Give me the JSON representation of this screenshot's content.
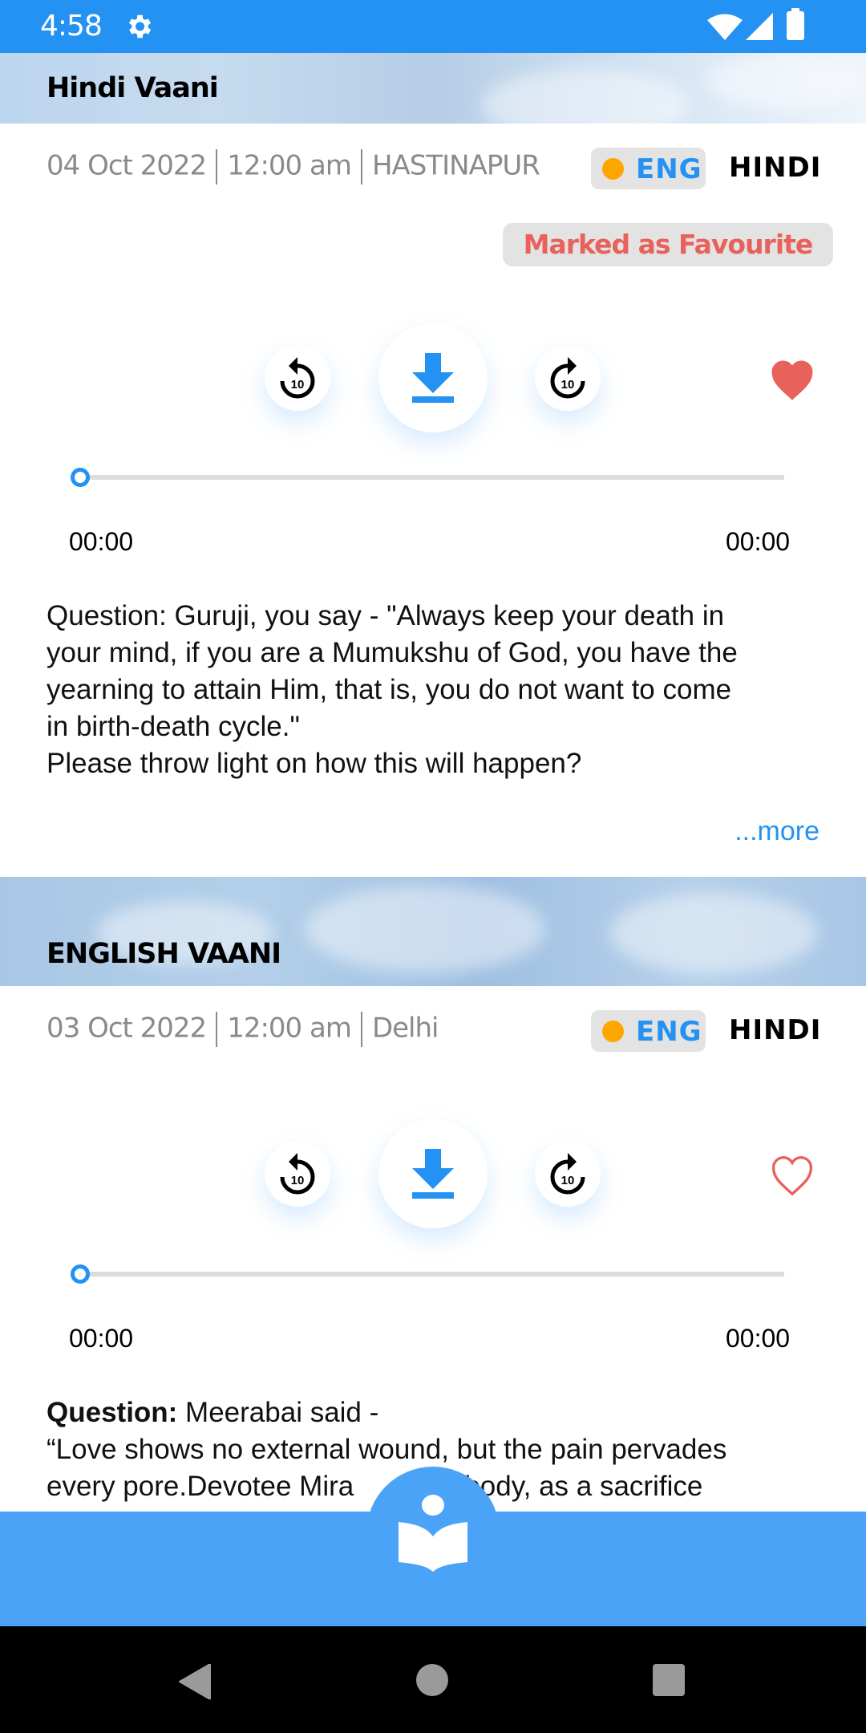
{
  "status_bar": {
    "time": "4:58",
    "icons": [
      "gear-icon",
      "wifi-icon",
      "signal-icon",
      "battery-icon"
    ]
  },
  "colors": {
    "accent": "#2392f2",
    "favourite": "#e8615a",
    "eng_dot": "#ffa500",
    "bottom_bar": "#4aa3f6"
  },
  "cards": [
    {
      "section_title": "Hindi Vaani",
      "date": "04 Oct 2022",
      "time": "12:00 am",
      "location": "HASTINAPUR",
      "lang_eng": "ENG",
      "lang_hindi": "HINDI",
      "favourite_badge": "Marked as Favourite",
      "is_favourite": true,
      "player": {
        "rewind_label": "10",
        "forward_label": "10",
        "progress": 0,
        "current_time": "00:00",
        "total_time": "00:00"
      },
      "question_lines": [
        "Question: Guruji, you say - \"Always keep your death in",
        "your mind, if you are a Mumukshu of God, you have the",
        "yearning to attain Him, that is, you do not want to come",
        "in birth-death cycle.\"",
        "Please throw light on how this will happen?"
      ],
      "more_label": "...more"
    },
    {
      "section_title": "ENGLISH VAANI",
      "date": "03 Oct 2022",
      "time": "12:00 am",
      "location": "Delhi",
      "lang_eng": "ENG",
      "lang_hindi": "HINDI",
      "is_favourite": false,
      "player": {
        "rewind_label": "10",
        "forward_label": "10",
        "progress": 0,
        "current_time": "00:00",
        "total_time": "00:00"
      },
      "question_prefix": "Question:",
      "question_lines": [
        " Meerabai said -",
        "“Love shows no external wound, but the pain pervades",
        "every pore.Devotee Mira        her body, as a sacrifice"
      ]
    }
  ],
  "bottom_bar": {
    "fab_icon": "book-reader-icon"
  },
  "nav_bar": {
    "buttons": [
      "back",
      "home",
      "recents"
    ]
  }
}
